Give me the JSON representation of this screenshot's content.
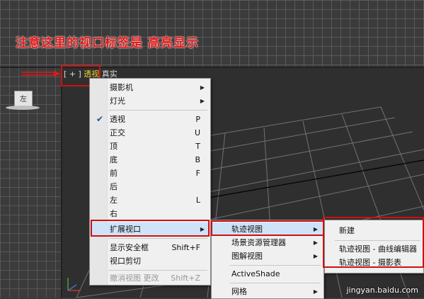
{
  "annotation": "注意这里的视口标签是 高亮显示",
  "viewport_label": {
    "prefix": "[ + ]",
    "mode": "透视",
    "shading": "真实"
  },
  "nav_cube_label": "左",
  "main_menu": [
    {
      "label": "摄影机",
      "submenu": true
    },
    {
      "label": "灯光",
      "submenu": true
    },
    {
      "label": "透视",
      "shortcut": "P",
      "checked": true
    },
    {
      "label": "正交",
      "shortcut": "U"
    },
    {
      "label": "顶",
      "shortcut": "T"
    },
    {
      "label": "底",
      "shortcut": "B"
    },
    {
      "label": "前",
      "shortcut": "F"
    },
    {
      "label": "后"
    },
    {
      "label": "左",
      "shortcut": "L"
    },
    {
      "label": "右"
    },
    {
      "label": "扩展视口",
      "submenu": true,
      "highlighted": true
    },
    {
      "label": "显示安全框",
      "shortcut": "Shift+F"
    },
    {
      "label": "视口剪切"
    },
    {
      "label": "撤消视图 更改",
      "shortcut": "Shift+Z",
      "disabled": true
    }
  ],
  "extended_menu": [
    {
      "label": "轨迹视图",
      "submenu": true,
      "highlighted": true
    },
    {
      "label": "场景资源管理器",
      "submenu": true
    },
    {
      "label": "图解视图",
      "submenu": true
    },
    {
      "label": "ActiveShade"
    },
    {
      "label": "网格",
      "submenu": true
    }
  ],
  "track_view_menu": [
    {
      "label": "新建"
    },
    {
      "label": "轨迹视图 - 曲线编辑器"
    },
    {
      "label": "轨迹视图 - 摄影表"
    }
  ],
  "watermark": "jingyan.baidu.com",
  "colors": {
    "annotation": "#e01818",
    "highlight_label": "#f2d22c",
    "menu_bg": "#f0f0f0",
    "highlight_box": "#d01010"
  }
}
